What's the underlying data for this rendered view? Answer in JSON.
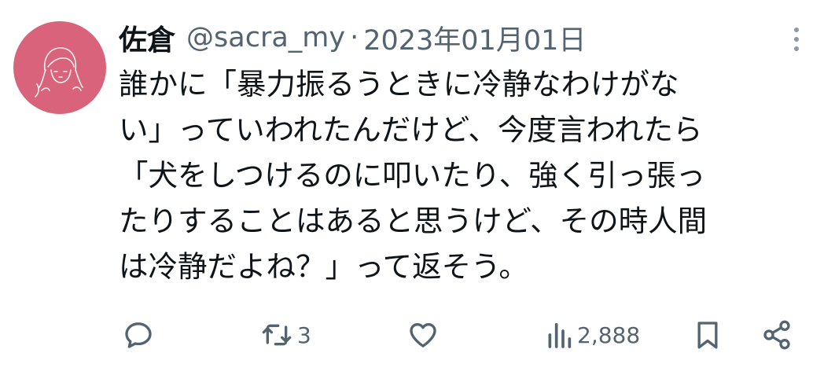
{
  "tweet": {
    "author_name": "佐倉",
    "handle": "@sacra_my",
    "separator": "·",
    "date": "2023年01月01日",
    "body_lines": [
      "誰かに「暴力振るうときに冷静なわけがな",
      "い」っていわれたんだけど、今度言われたら",
      "「犬をしつけるのに叩いたり、強く引っ張っ",
      "たりすることはあると思うけど、その時人間",
      "は冷静だよね？」って返そう。"
    ]
  },
  "actions": {
    "reply": {
      "icon": "reply-icon"
    },
    "retweet": {
      "icon": "retweet-icon",
      "count": "3"
    },
    "like": {
      "icon": "heart-icon"
    },
    "views": {
      "icon": "views-icon",
      "count": "2,888"
    },
    "bookmark": {
      "icon": "bookmark-icon"
    },
    "share": {
      "icon": "share-icon"
    }
  },
  "colors": {
    "avatar_bg": "#d9637a",
    "text": "#0f1419",
    "secondary": "#536471"
  }
}
